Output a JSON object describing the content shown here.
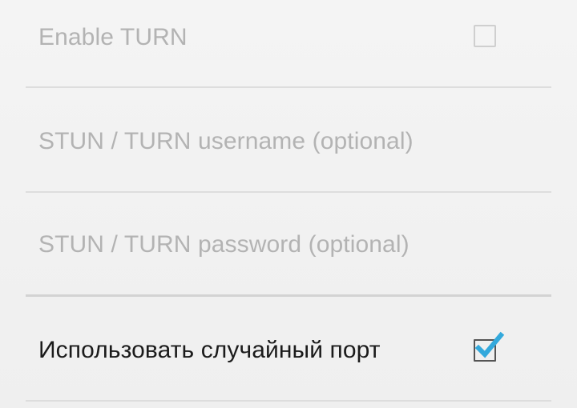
{
  "settings": {
    "enable_turn": {
      "label": "Enable TURN",
      "checked": false,
      "enabled": false
    },
    "stun_turn_username": {
      "label": "STUN / TURN username (optional)",
      "enabled": false
    },
    "stun_turn_password": {
      "label": "STUN / TURN password (optional)",
      "enabled": false
    },
    "use_random_port": {
      "label": "Использовать случайный порт",
      "checked": true,
      "enabled": true
    }
  },
  "colors": {
    "check_accent": "#33a9dc",
    "disabled_text": "#b3b3b3",
    "primary_text": "#1b1b1b"
  },
  "icons": {
    "unchecked": "checkbox-unchecked-icon",
    "checked": "checkbox-checked-icon"
  }
}
